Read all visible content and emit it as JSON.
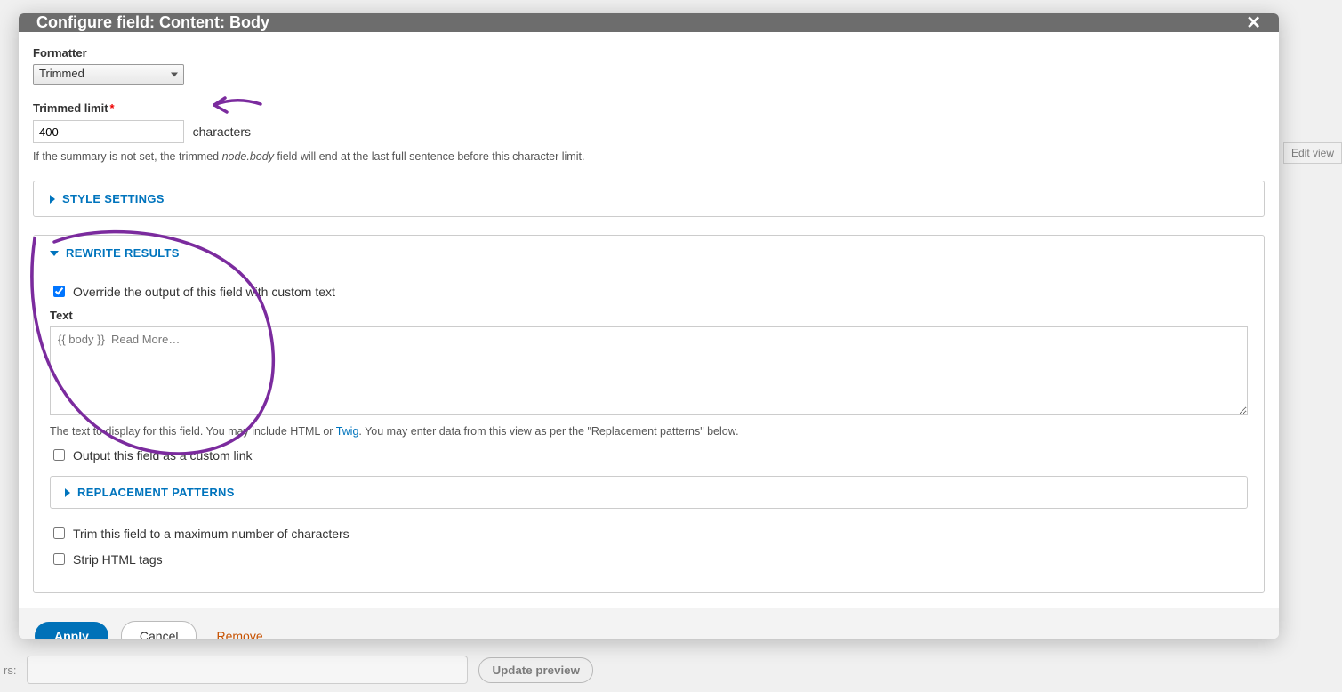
{
  "modal": {
    "title": "Configure field: Content: Body",
    "close_icon": "✕"
  },
  "formatter": {
    "label": "Formatter",
    "value": "Trimmed"
  },
  "trimmed_limit": {
    "label": "Trimmed limit",
    "value": "400",
    "suffix": "characters",
    "description_a": "If the summary is not set, the trimmed ",
    "description_em": "node.body",
    "description_b": " field will end at the last full sentence before this character limit."
  },
  "style_settings": {
    "label": "STYLE SETTINGS"
  },
  "rewrite": {
    "label": "REWRITE RESULTS",
    "override": {
      "label": "Override the output of this field with custom text",
      "checked": true
    },
    "text": {
      "label": "Text",
      "value": "{{ body }}  Read More…",
      "help_a": "The text to display for this field. You may include HTML or ",
      "help_link": "Twig",
      "help_b": ". You may enter data from this view as per the \"Replacement patterns\" below."
    },
    "custom_link": {
      "label": "Output this field as a custom link",
      "checked": false
    },
    "replacement_patterns": {
      "label": "REPLACEMENT PATTERNS"
    },
    "trim": {
      "label": "Trim this field to a maximum number of characters",
      "checked": false
    },
    "strip_html": {
      "label": "Strip HTML tags",
      "checked": false
    }
  },
  "footer": {
    "apply": "Apply",
    "cancel": "Cancel",
    "remove": "Remove"
  },
  "bg": {
    "edit_view": "Edit view",
    "filters_label": "rs:",
    "update_preview": "Update preview"
  }
}
